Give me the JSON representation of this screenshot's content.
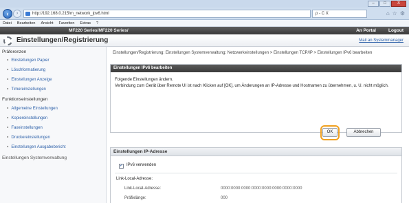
{
  "browser": {
    "url": "http://192.168.0.215/m_network_ipv6.html",
    "addr_controls": "ρ - C X",
    "menu": [
      "Datei",
      "Bearbeiten",
      "Ansicht",
      "Favoriten",
      "Extras",
      "?"
    ],
    "win_buttons": [
      "–",
      "□",
      "X"
    ]
  },
  "device_bar": {
    "model": "MF220 Series/MF220 Series/",
    "portal": "An Portal",
    "logout": "Logout"
  },
  "page": {
    "title": "Einstellungen/Registrierung",
    "mail_link": "Mail an Systemmanager"
  },
  "sidebar": {
    "groups": [
      {
        "label": "Präferenzen",
        "items": [
          "Einstellungen Papier",
          "Löschformatierung",
          "Einstellungen Anzeige",
          "Timereinstellungen"
        ]
      },
      {
        "label": "Funktionseinstellungen",
        "items": [
          "Allgemeine Einstellungen",
          "Kopiereinstellungen",
          "Faxeinstellungen",
          "Druckereinstellungen",
          "Einstellungen Ausgabebericht"
        ]
      },
      {
        "label": "Einstellungen Systemverwaltung",
        "items": []
      }
    ]
  },
  "breadcrumb": "Einstellungen/Registrierung: Einstellungen Systemverwaltung: Netzwerkeinstellungen > Einstellungen TCP/IP > Einstellungen IPv6 bearbeiten",
  "edit_panel": {
    "title": "Einstellungen IPv6 bearbeiten",
    "intro": "Folgende Einstellungen ändern.",
    "message": "Verbindung zum Gerät über Remote UI ist nach Klicken auf [OK], um Änderungen an IP-Adresse und Hostnamen zu übernehmen, u. U. nicht möglich.",
    "ok_label": "OK",
    "cancel_label": "Abbrechen"
  },
  "ip_panel": {
    "title": "Einstellungen IP-Adresse",
    "use_ipv6_label": "IPv6 verwenden",
    "use_ipv6_checked": true,
    "link_local_heading": "Link-Local-Adresse:",
    "rows": [
      {
        "label": "Link-Local-Adresse:",
        "value": "0000:0000:0000:0000:0000:0000:0000:0000"
      },
      {
        "label": "Präfixlänge:",
        "value": "000"
      }
    ]
  },
  "colors": {
    "ok_highlight": "#f0a020",
    "dark_header": "#3b3b3b",
    "link": "#2b5fa8"
  }
}
